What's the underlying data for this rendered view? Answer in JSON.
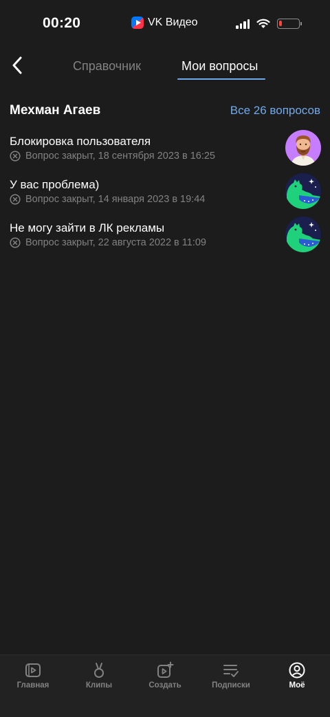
{
  "status_bar": {
    "time": "00:20",
    "app_name": "VK Видео",
    "battery_level": 0.15
  },
  "nav": {
    "tabs": [
      {
        "label": "Справочник",
        "active": false
      },
      {
        "label": "Мои вопросы",
        "active": true
      }
    ]
  },
  "section": {
    "title": "Мехман Агаев",
    "all_link": "Все 26 вопросов"
  },
  "questions": [
    {
      "title": "Блокировка пользователя",
      "status": "Вопрос закрыт, 18 сентября 2023 в 16:25",
      "avatar": "bearded-man-avatar"
    },
    {
      "title": "У вас проблема)",
      "status": "Вопрос закрыт, 14 января 2023 в 19:44",
      "avatar": "green-dino-avatar"
    },
    {
      "title": "Не могу зайти в ЛК рекламы",
      "status": "Вопрос закрыт, 22 августа 2022 в 11:09",
      "avatar": "green-dino-avatar"
    }
  ],
  "tab_bar": {
    "items": [
      {
        "label": "Главная",
        "icon": "home-play-icon",
        "active": false
      },
      {
        "label": "Клипы",
        "icon": "clips-icon",
        "active": false
      },
      {
        "label": "Создать",
        "icon": "create-video-icon",
        "active": false
      },
      {
        "label": "Подписки",
        "icon": "subscriptions-icon",
        "active": false
      },
      {
        "label": "Моё",
        "icon": "profile-icon",
        "active": true
      }
    ]
  },
  "colors": {
    "background": "#1c1c1d",
    "accent": "#71aaeb",
    "secondary_text": "#828282",
    "tab_bar": "#222222"
  }
}
